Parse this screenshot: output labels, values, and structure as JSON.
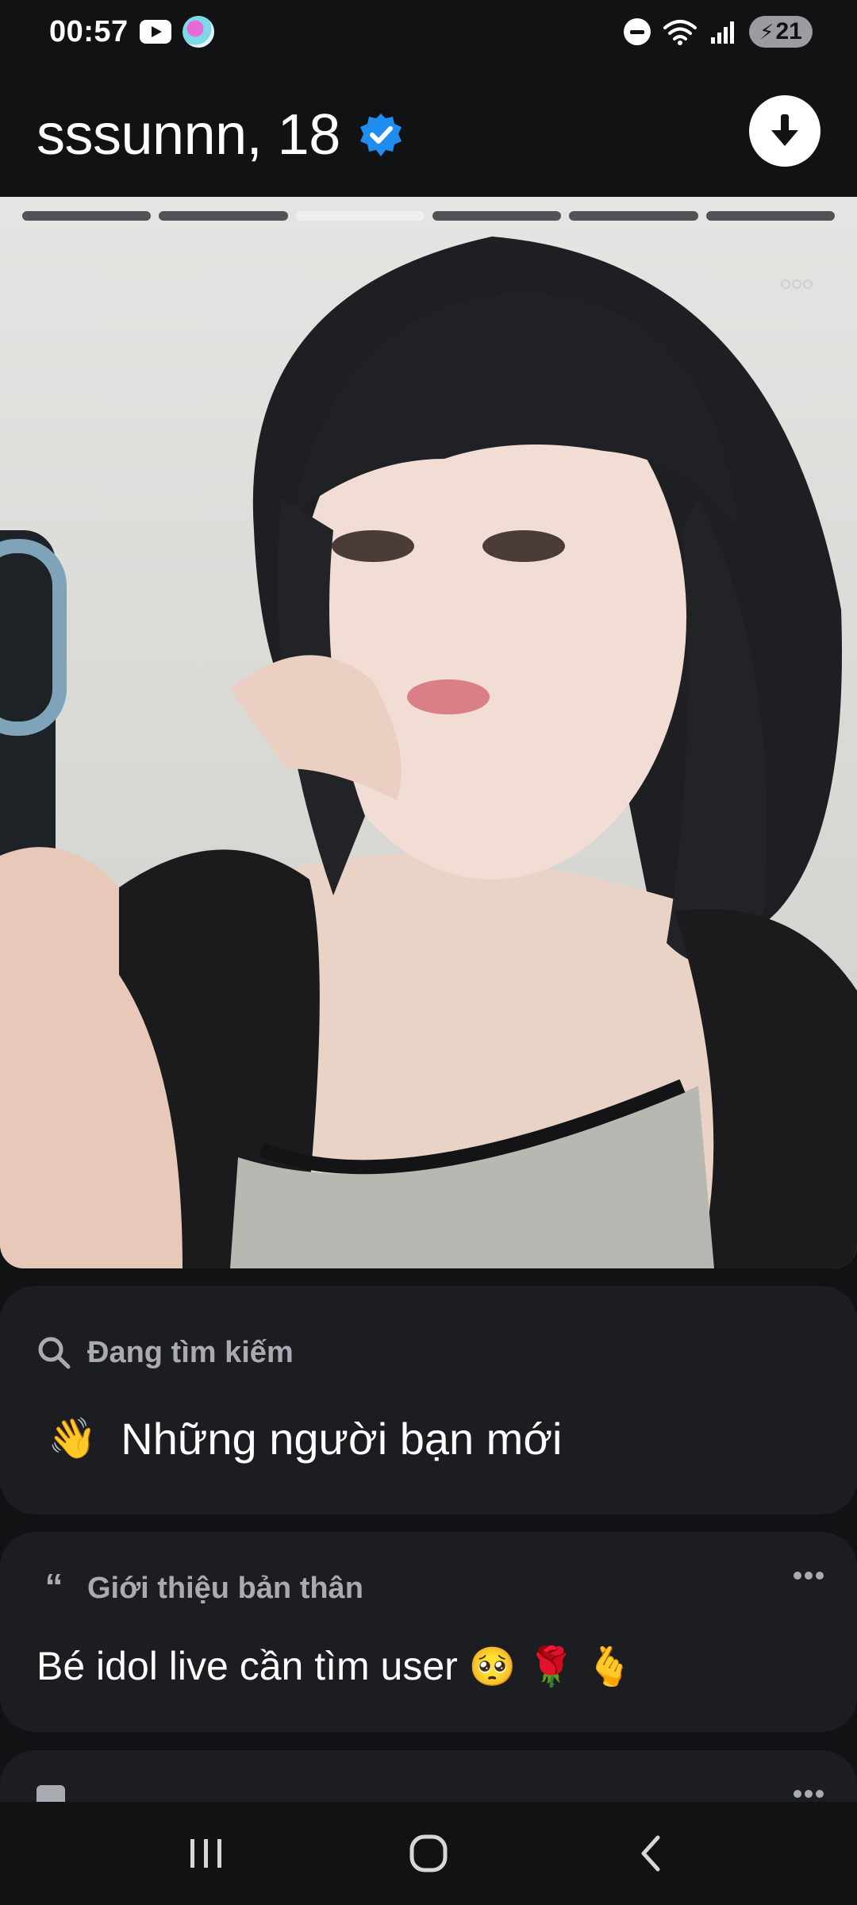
{
  "status_bar": {
    "time": "00:57",
    "battery_level": "21",
    "icons": [
      "youtube-icon",
      "app-notification-icon",
      "do-not-disturb-icon",
      "wifi-icon",
      "signal-icon",
      "battery-icon"
    ]
  },
  "profile": {
    "name_age": "sssunnn, 18",
    "verified": true,
    "photo_count": 6,
    "active_photo_index": 2
  },
  "looking_for": {
    "label": "Đang tìm kiếm",
    "value": "Những người bạn mới",
    "emoji": "👋"
  },
  "about": {
    "label": "Giới thiệu bản thân",
    "text": "Bé idol live cần tìm user",
    "emojis": [
      "🥺",
      "🌹",
      "🫰"
    ]
  },
  "colors": {
    "background": "#111214",
    "card": "#1c1d21",
    "verified_blue": "#1f8cf0",
    "label_gray": "#a8abb1"
  }
}
